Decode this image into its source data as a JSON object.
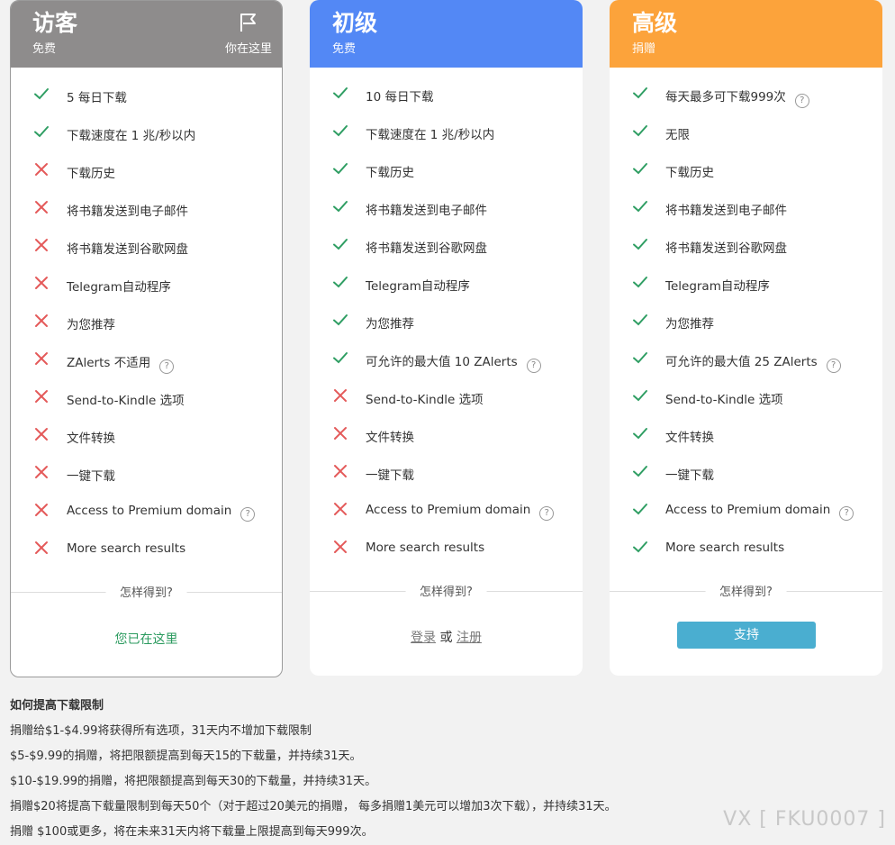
{
  "colors": {
    "check": "#2f9e63",
    "cross": "#e45a5a",
    "guest": "#8e8c8c",
    "basic": "#5388f5",
    "premium": "#fca33b",
    "button": "#4aaed0"
  },
  "plans": [
    {
      "title": "访客",
      "subtitle": "免费",
      "you_are_here": "你在这里",
      "features": [
        {
          "status": "check",
          "text": "5 每日下载"
        },
        {
          "status": "check",
          "text": "下载速度在 1 兆/秒以内"
        },
        {
          "status": "cross",
          "text": "下载历史"
        },
        {
          "status": "cross",
          "text": "将书籍发送到电子邮件"
        },
        {
          "status": "cross",
          "text": "将书籍发送到谷歌网盘"
        },
        {
          "status": "cross",
          "text": "Telegram自动程序"
        },
        {
          "status": "cross",
          "text": "为您推荐"
        },
        {
          "status": "cross",
          "text": "ZAlerts 不适用",
          "help": true
        },
        {
          "status": "cross",
          "text": "Send-to-Kindle 选项"
        },
        {
          "status": "cross",
          "text": "文件转换"
        },
        {
          "status": "cross",
          "text": "一键下载"
        },
        {
          "status": "cross",
          "text": "Access to Premium domain",
          "help": true
        },
        {
          "status": "cross",
          "text": "More search results"
        }
      ],
      "how": "怎样得到?",
      "action": "您已在这里"
    },
    {
      "title": "初级",
      "subtitle": "免费",
      "features": [
        {
          "status": "check",
          "text": "10 每日下载"
        },
        {
          "status": "check",
          "text": "下载速度在 1 兆/秒以内"
        },
        {
          "status": "check",
          "text": "下载历史"
        },
        {
          "status": "check",
          "text": "将书籍发送到电子邮件"
        },
        {
          "status": "check",
          "text": "将书籍发送到谷歌网盘"
        },
        {
          "status": "check",
          "text": "Telegram自动程序"
        },
        {
          "status": "check",
          "text": "为您推荐"
        },
        {
          "status": "check",
          "text": "可允许的最大值 10 ZAlerts",
          "help": true
        },
        {
          "status": "cross",
          "text": "Send-to-Kindle 选项"
        },
        {
          "status": "cross",
          "text": "文件转换"
        },
        {
          "status": "cross",
          "text": "一键下载"
        },
        {
          "status": "cross",
          "text": "Access to Premium domain",
          "help": true
        },
        {
          "status": "cross",
          "text": "More search results"
        }
      ],
      "how": "怎样得到?",
      "login": "登录",
      "or": "或",
      "register": "注册"
    },
    {
      "title": "高级",
      "subtitle": "捐赠",
      "features": [
        {
          "status": "check",
          "text": "每天最多可下载999次",
          "help": true
        },
        {
          "status": "check",
          "text": "无限"
        },
        {
          "status": "check",
          "text": "下载历史"
        },
        {
          "status": "check",
          "text": "将书籍发送到电子邮件"
        },
        {
          "status": "check",
          "text": "将书籍发送到谷歌网盘"
        },
        {
          "status": "check",
          "text": "Telegram自动程序"
        },
        {
          "status": "check",
          "text": "为您推荐"
        },
        {
          "status": "check",
          "text": "可允许的最大值 25 ZAlerts",
          "help": true
        },
        {
          "status": "check",
          "text": "Send-to-Kindle 选项"
        },
        {
          "status": "check",
          "text": "文件转换"
        },
        {
          "status": "check",
          "text": "一键下载"
        },
        {
          "status": "check",
          "text": "Access to Premium domain",
          "help": true
        },
        {
          "status": "check",
          "text": "More search results"
        }
      ],
      "how": "怎样得到?",
      "button": "支持"
    }
  ],
  "notes": {
    "heading": "如何提高下载限制",
    "lines": [
      "捐赠给$1-$4.99将获得所有选项，31天内不增加下载限制",
      "$5-$9.99的捐赠，将把限额提高到每天15的下载量，并持续31天。",
      "$10-$19.99的捐赠，将把限额提高到每天30的下载量，并持续31天。",
      "捐赠$20将提高下载量限制到每天50个（对于超过20美元的捐赠， 每多捐赠1美元可以增加3次下载），并持续31天。",
      "捐赠 $100或更多，将在未来31天内将下载量上限提高到每天999次。"
    ]
  },
  "watermark": "VX [ FKU0007 ]"
}
